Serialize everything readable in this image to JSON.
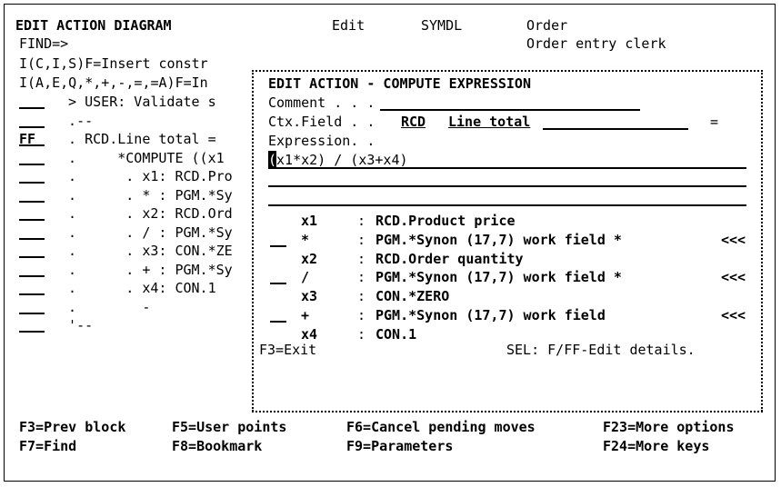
{
  "header": {
    "title": "EDIT ACTION DIAGRAM",
    "mode": "Edit",
    "model": "SYMDL",
    "object": "Order",
    "object_desc": "Order entry clerk",
    "find_label": "FIND=>"
  },
  "left": {
    "insert_line_1": "I(C,I,S)F=Insert constr",
    "insert_line_2": "I(A,E,Q,*,+,-,=,=A)F=In",
    "rows": [
      {
        "sel": "",
        "text": "  > USER: Validate s"
      },
      {
        "sel": "",
        "text": "  .--"
      },
      {
        "sel": "FF",
        "text": "  . RCD.Line total ="
      },
      {
        "sel": "",
        "text": "  .     *COMPUTE ((x1"
      },
      {
        "sel": "",
        "text": "  .      . x1: RCD.Pro"
      },
      {
        "sel": "",
        "text": "  .      . * : PGM.*Sy"
      },
      {
        "sel": "",
        "text": "  .      . x2: RCD.Ord"
      },
      {
        "sel": "",
        "text": "  .      . / : PGM.*Sy"
      },
      {
        "sel": "",
        "text": "  .      . x3: CON.*ZE"
      },
      {
        "sel": "",
        "text": "  .      . + : PGM.*Sy"
      },
      {
        "sel": "",
        "text": "  .      . x4: CON.1"
      },
      {
        "sel": "",
        "text": "  .        -"
      },
      {
        "sel": "",
        "text": "  '--"
      }
    ]
  },
  "window": {
    "title": "EDIT ACTION - COMPUTE EXPRESSION",
    "comment_label": "Comment . . .",
    "ctx_label": "Ctx.Field . .",
    "ctx_value": "RCD",
    "field_value": "Line total",
    "equals": "=",
    "expression_label": "Expression. .",
    "expression_first_char": "(",
    "expression_rest": "x1*x2) / (x3+x4)",
    "operands": [
      {
        "sel": false,
        "op": "x1",
        "desc": "RCD.Product price",
        "more": ""
      },
      {
        "sel": true,
        "op": "*",
        "desc": "PGM.*Synon (17,7) work field *",
        "more": "<<<"
      },
      {
        "sel": false,
        "op": "x2",
        "desc": "RCD.Order quantity",
        "more": ""
      },
      {
        "sel": true,
        "op": "/",
        "desc": "PGM.*Synon (17,7) work field *",
        "more": "<<<"
      },
      {
        "sel": false,
        "op": "x3",
        "desc": "CON.*ZERO",
        "more": ""
      },
      {
        "sel": true,
        "op": "+",
        "desc": "PGM.*Synon (17,7) work field",
        "more": "<<<"
      },
      {
        "sel": false,
        "op": "x4",
        "desc": "CON.1",
        "more": ""
      }
    ],
    "exit_key": "F3=Exit",
    "sel_hint": "SEL: F/FF-Edit details."
  },
  "footer": {
    "row1": [
      "F3=Prev block",
      "F5=User points",
      "F6=Cancel pending moves",
      "F23=More options"
    ],
    "row2": [
      "F7=Find",
      "F8=Bookmark",
      "F9=Parameters",
      "F24=More keys"
    ]
  }
}
